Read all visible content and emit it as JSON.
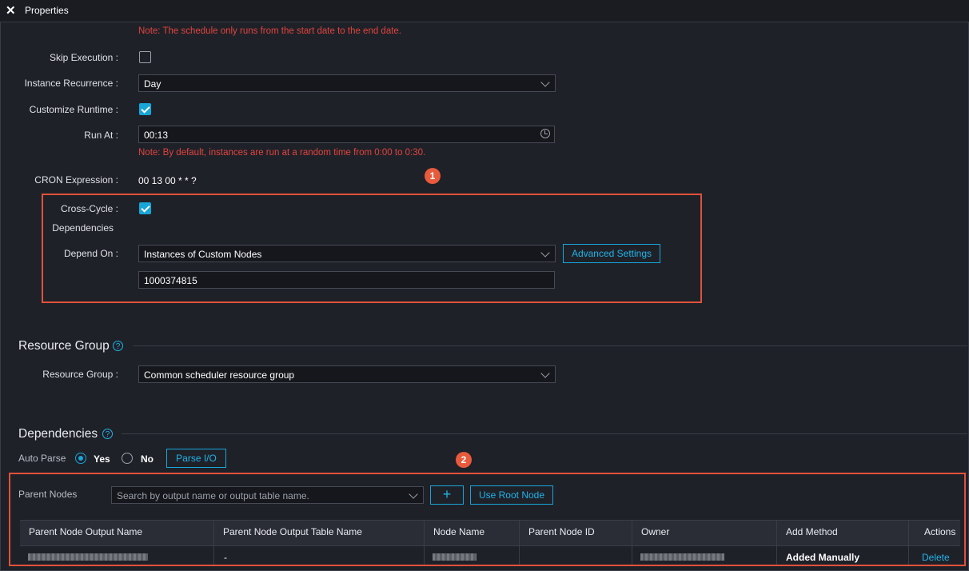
{
  "window": {
    "title": "Properties"
  },
  "schedule": {
    "note_date_range": "Note: The schedule only runs from the start date to the end date.",
    "skip_execution_label": "Skip Execution :",
    "skip_execution_checked": false,
    "instance_recurrence_label": "Instance Recurrence :",
    "instance_recurrence_value": "Day",
    "customize_runtime_label": "Customize Runtime :",
    "customize_runtime_checked": true,
    "run_at_label": "Run At :",
    "run_at_value": "00:13",
    "note_random_time": "Note: By default, instances are run at a random time from 0:00 to 0:30.",
    "cron_label": "CRON Expression :",
    "cron_value": "00 13 00 * * ?",
    "cross_cycle_label_1": "Cross-Cycle :",
    "cross_cycle_label_2": "Dependencies",
    "cross_cycle_checked": true,
    "depend_on_label": "Depend On :",
    "depend_on_value": "Instances of Custom Nodes",
    "advanced_settings_label": "Advanced Settings",
    "custom_node_id": "1000374815"
  },
  "badges": {
    "one": "1",
    "two": "2"
  },
  "resource_group": {
    "section_title": "Resource Group",
    "label": "Resource Group :",
    "value": "Common scheduler resource group"
  },
  "dependencies": {
    "section_title": "Dependencies",
    "auto_parse_label": "Auto Parse",
    "yes_label": "Yes",
    "no_label": "No",
    "auto_parse_value": "Yes",
    "parse_io_label": "Parse I/O",
    "parent_nodes_label": "Parent Nodes",
    "search_placeholder": "Search by output name or output table name.",
    "add_label": "+",
    "use_root_label": "Use Root Node",
    "columns": [
      "Parent Node Output Name",
      "Parent Node Output Table Name",
      "Node Name",
      "Parent Node ID",
      "Owner",
      "Add Method",
      "Actions"
    ],
    "rows": [
      {
        "output_table_name": "-",
        "add_method": "Added Manually",
        "action": "Delete"
      }
    ]
  },
  "colors": {
    "accent": "#17a6d8",
    "warning": "#e0443c",
    "highlight_box": "#e0523a",
    "background": "#1f2129"
  }
}
